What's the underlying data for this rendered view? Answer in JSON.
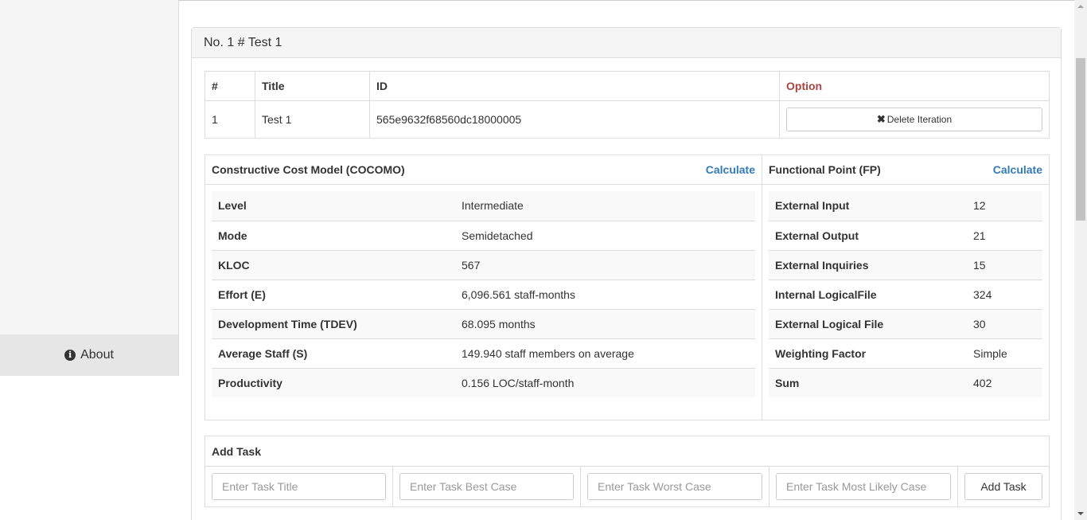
{
  "sidebar": {
    "about_label": "About",
    "about_icon": "info-circle-icon"
  },
  "panel": {
    "title": "No. 1 # Test 1"
  },
  "iteration_table": {
    "headers": [
      "#",
      "Title",
      "ID",
      "Option"
    ],
    "rows": [
      {
        "num": "1",
        "title": "Test 1",
        "id": "565e9632f68560dc18000005",
        "action_label": "Delete Iteration",
        "action_icon": "remove-icon"
      }
    ]
  },
  "cocomo": {
    "title": "Constructive Cost Model (COCOMO)",
    "calculate_label": "Calculate",
    "rows": [
      {
        "label": "Level",
        "value": "Intermediate"
      },
      {
        "label": "Mode",
        "value": "Semidetached"
      },
      {
        "label": "KLOC",
        "value": "567"
      },
      {
        "label": "Effort (E)",
        "value": "6,096.561 staff-months"
      },
      {
        "label": "Development Time (TDEV)",
        "value": "68.095 months"
      },
      {
        "label": "Average Staff (S)",
        "value": "149.940 staff members on average"
      },
      {
        "label": "Productivity",
        "value": "0.156 LOC/staff-month"
      }
    ]
  },
  "fp": {
    "title": "Functional Point (FP)",
    "calculate_label": "Calculate",
    "rows": [
      {
        "label": "External Input",
        "value": "12"
      },
      {
        "label": "External Output",
        "value": "21"
      },
      {
        "label": "External Inquiries",
        "value": "15"
      },
      {
        "label": "Internal LogicalFile",
        "value": "324"
      },
      {
        "label": "External Logical File",
        "value": "30"
      },
      {
        "label": "Weighting Factor",
        "value": "Simple"
      },
      {
        "label": "Sum",
        "value": "402"
      }
    ]
  },
  "add_task": {
    "title": "Add Task",
    "title_placeholder": "Enter Task Title",
    "best_placeholder": "Enter Task Best Case",
    "worst_placeholder": "Enter Task Worst Case",
    "likely_placeholder": "Enter Task Most Likely Case",
    "button_label": "Add Task"
  },
  "colors": {
    "link": "#337ab7",
    "option_header": "#a94442"
  }
}
